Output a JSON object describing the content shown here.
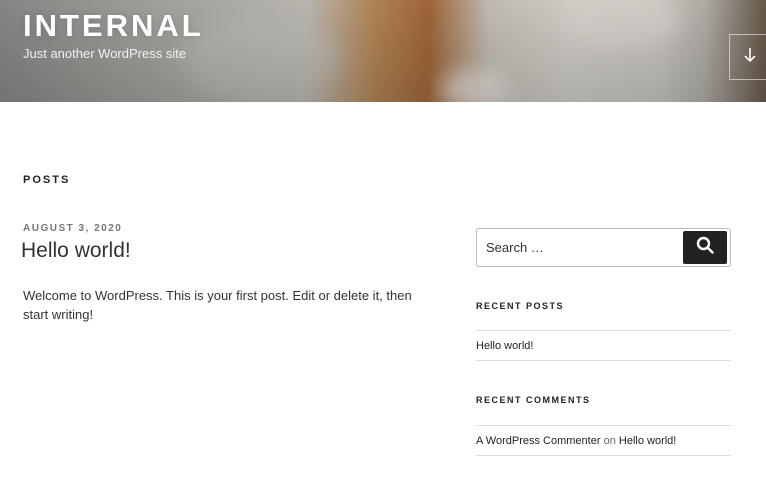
{
  "header": {
    "site_title": "INTERNAL",
    "tagline": "Just another WordPress site",
    "scroll_down_icon": "arrow-down-icon"
  },
  "main": {
    "page_heading": "POSTS",
    "post": {
      "date": "AUGUST 3, 2020",
      "title": "Hello world!",
      "content": "Welcome to WordPress. This is your first post. Edit or delete it, then start writing!"
    }
  },
  "sidebar": {
    "search": {
      "placeholder": "Search …",
      "button_icon": "search-icon"
    },
    "recent_posts": {
      "title": "RECENT POSTS",
      "items": [
        "Hello world!"
      ]
    },
    "recent_comments": {
      "title": "RECENT COMMENTS",
      "items": [
        {
          "author": "A WordPress Commenter",
          "connector": "on",
          "post": "Hello world!"
        }
      ]
    }
  },
  "colors": {
    "text": "#333333",
    "meta": "#767676",
    "button_bg": "#222222",
    "divider": "#dddddd"
  }
}
